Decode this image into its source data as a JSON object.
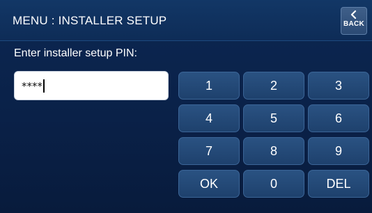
{
  "header": {
    "title": "MENU : INSTALLER SETUP",
    "back_label": "BACK",
    "back_icon": "chevron-left-icon"
  },
  "pin_entry": {
    "prompt": "Enter installer setup PIN:",
    "value": "****"
  },
  "keypad": {
    "keys": [
      "1",
      "2",
      "3",
      "4",
      "5",
      "6",
      "7",
      "8",
      "9",
      "OK",
      "0",
      "DEL"
    ]
  },
  "colors": {
    "background": "#0c2248",
    "header": "#123766",
    "key": "#2a5282",
    "key_border": "#3b6597",
    "field": "#ffffff"
  }
}
